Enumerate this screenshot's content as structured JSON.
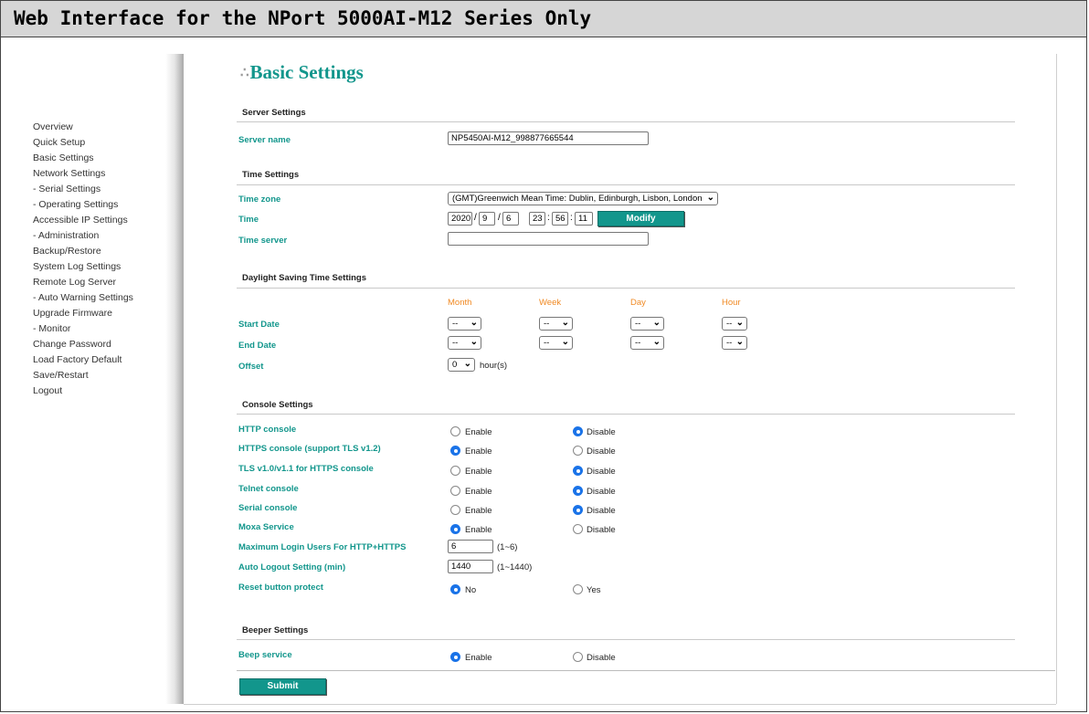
{
  "banner_title": "Web Interface for the NPort 5000AI-M12 Series Only",
  "sidebar": {
    "items": [
      {
        "label": "Overview"
      },
      {
        "label": "Quick Setup"
      },
      {
        "label": "Basic Settings"
      },
      {
        "label": "Network Settings"
      },
      {
        "label": "- Serial Settings"
      },
      {
        "label": "- Operating Settings"
      },
      {
        "label": "Accessible IP Settings"
      },
      {
        "label": "- Administration"
      },
      {
        "label": "Backup/Restore"
      },
      {
        "label": "System Log Settings"
      },
      {
        "label": "Remote Log Server"
      },
      {
        "label": "- Auto Warning Settings"
      },
      {
        "label": "Upgrade Firmware"
      },
      {
        "label": "- Monitor"
      },
      {
        "label": "Change Password"
      },
      {
        "label": "Load Factory Default"
      },
      {
        "label": "Save/Restart"
      },
      {
        "label": "Logout"
      }
    ]
  },
  "page_title": "Basic Settings",
  "server": {
    "heading": "Server Settings",
    "name_label": "Server name",
    "name_value": "NP5450AI-M12_998877665544"
  },
  "time": {
    "heading": "Time Settings",
    "zone_label": "Time zone",
    "zone_value": "(GMT)Greenwich Mean Time: Dublin, Edinburgh, Lisbon, London",
    "time_label": "Time",
    "year": "2020",
    "month": "9",
    "day": "6",
    "hour": "23",
    "minute": "56",
    "second": "11",
    "slash": "/",
    "colon": ":",
    "modify_label": "Modify",
    "server_label": "Time server",
    "server_value": ""
  },
  "dst": {
    "heading": "Daylight Saving Time Settings",
    "col_month": "Month",
    "col_week": "Week",
    "col_day": "Day",
    "col_hour": "Hour",
    "start_label": "Start Date",
    "end_label": "End Date",
    "placeholder": "--",
    "offset_label": "Offset",
    "offset_value": "0",
    "offset_unit": "hour(s)"
  },
  "console": {
    "heading": "Console Settings",
    "enable": "Enable",
    "disable": "Disable",
    "rows": [
      {
        "label": "HTTP console",
        "selected": "Disable"
      },
      {
        "label": "HTTPS console (support TLS v1.2)",
        "selected": "Enable"
      },
      {
        "label": "TLS v1.0/v1.1 for HTTPS console",
        "selected": "Disable"
      },
      {
        "label": "Telnet console",
        "selected": "Disable"
      },
      {
        "label": "Serial console",
        "selected": "Disable"
      },
      {
        "label": "Moxa Service",
        "selected": "Enable"
      }
    ],
    "max_login_label": "Maximum Login Users For HTTP+HTTPS",
    "max_login_value": "6",
    "max_login_range": "(1~6)",
    "auto_logout_label": "Auto Logout Setting (min)",
    "auto_logout_value": "1440",
    "auto_logout_range": "(1~1440)",
    "reset_label": "Reset button protect",
    "reset_no": "No",
    "reset_yes": "Yes",
    "reset_selected": "No"
  },
  "beeper": {
    "heading": "Beeper Settings",
    "beep_label": "Beep service",
    "enable": "Enable",
    "disable": "Disable",
    "selected": "Enable"
  },
  "submit_label": "Submit",
  "colors": {
    "accent": "#12968c",
    "column_header": "#f08a24",
    "radio_checked": "#1a73e8",
    "banner": "#d6d6d6"
  }
}
